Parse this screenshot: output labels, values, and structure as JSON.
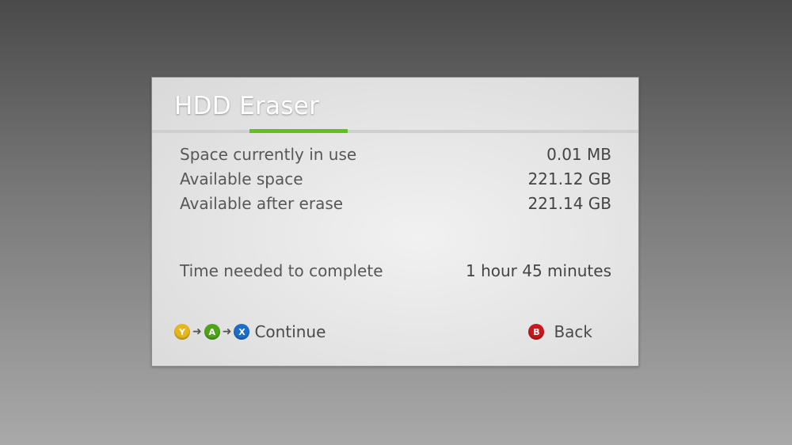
{
  "dialog": {
    "title": "HDD Eraser",
    "rows": [
      {
        "label": "Space currently in use",
        "value": "0.01 MB"
      },
      {
        "label": "Available space",
        "value": "221.12 GB"
      },
      {
        "label": "Available after erase",
        "value": "221.14 GB"
      },
      {
        "label": "Time needed to complete",
        "value": "1 hour 45 minutes"
      }
    ]
  },
  "footer": {
    "continue": {
      "buttons": [
        {
          "glyph": "Y",
          "color": "#e7b61c",
          "icon": "y-button-icon"
        },
        {
          "glyph": "A",
          "color": "#4fa51a",
          "icon": "a-button-icon"
        },
        {
          "glyph": "X",
          "color": "#1b6fcb",
          "icon": "x-button-icon"
        }
      ],
      "arrow": "➜",
      "label": "Continue"
    },
    "back": {
      "glyph": "B",
      "color": "#c8181c",
      "icon": "b-button-icon",
      "label": "Back"
    }
  },
  "colors": {
    "accent": "#5dc21e"
  }
}
